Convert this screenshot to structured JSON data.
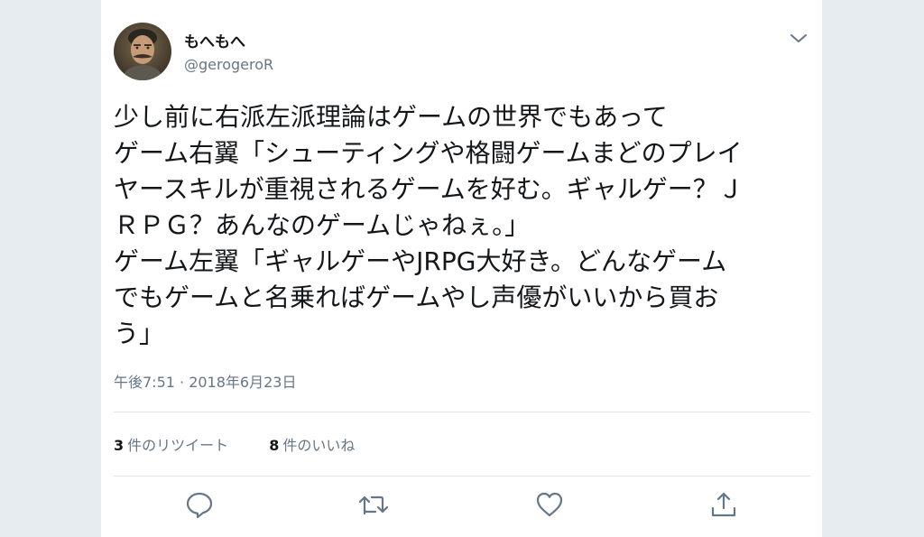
{
  "tweet": {
    "display_name": "もへもへ",
    "handle": "@gerogeroR",
    "text_lines": [
      "少し前に右派左派理論はゲームの世界でもあって",
      "ゲーム右翼「シューティングや格闘ゲームまどのプレイ",
      "ヤースキルが重視されるゲームを好む。ギャルゲー？Ｊ",
      "ＲＰＧ？あんなのゲームじゃねぇ。」",
      "ゲーム左翼「ギャルゲーやJRPG大好き。どんなゲーム",
      "でもゲームと名乗ればゲームやし声優がいいから買お",
      "う」"
    ],
    "timestamp": "午後7:51 · 2018年6月23日",
    "retweets": {
      "count": "3",
      "label": "件のリツイート"
    },
    "likes": {
      "count": "8",
      "label": "件のいいね"
    }
  },
  "icons": {
    "avatar": "avatar-portrait",
    "menu": "chevron-down-icon",
    "reply": "reply-icon",
    "retweet": "retweet-icon",
    "like": "heart-icon",
    "share": "share-icon"
  },
  "colors": {
    "background": "#e6ecf0",
    "text": "#14171a",
    "secondary_text": "#657786",
    "icon": "#657786",
    "divider": "#e1e8ed"
  }
}
